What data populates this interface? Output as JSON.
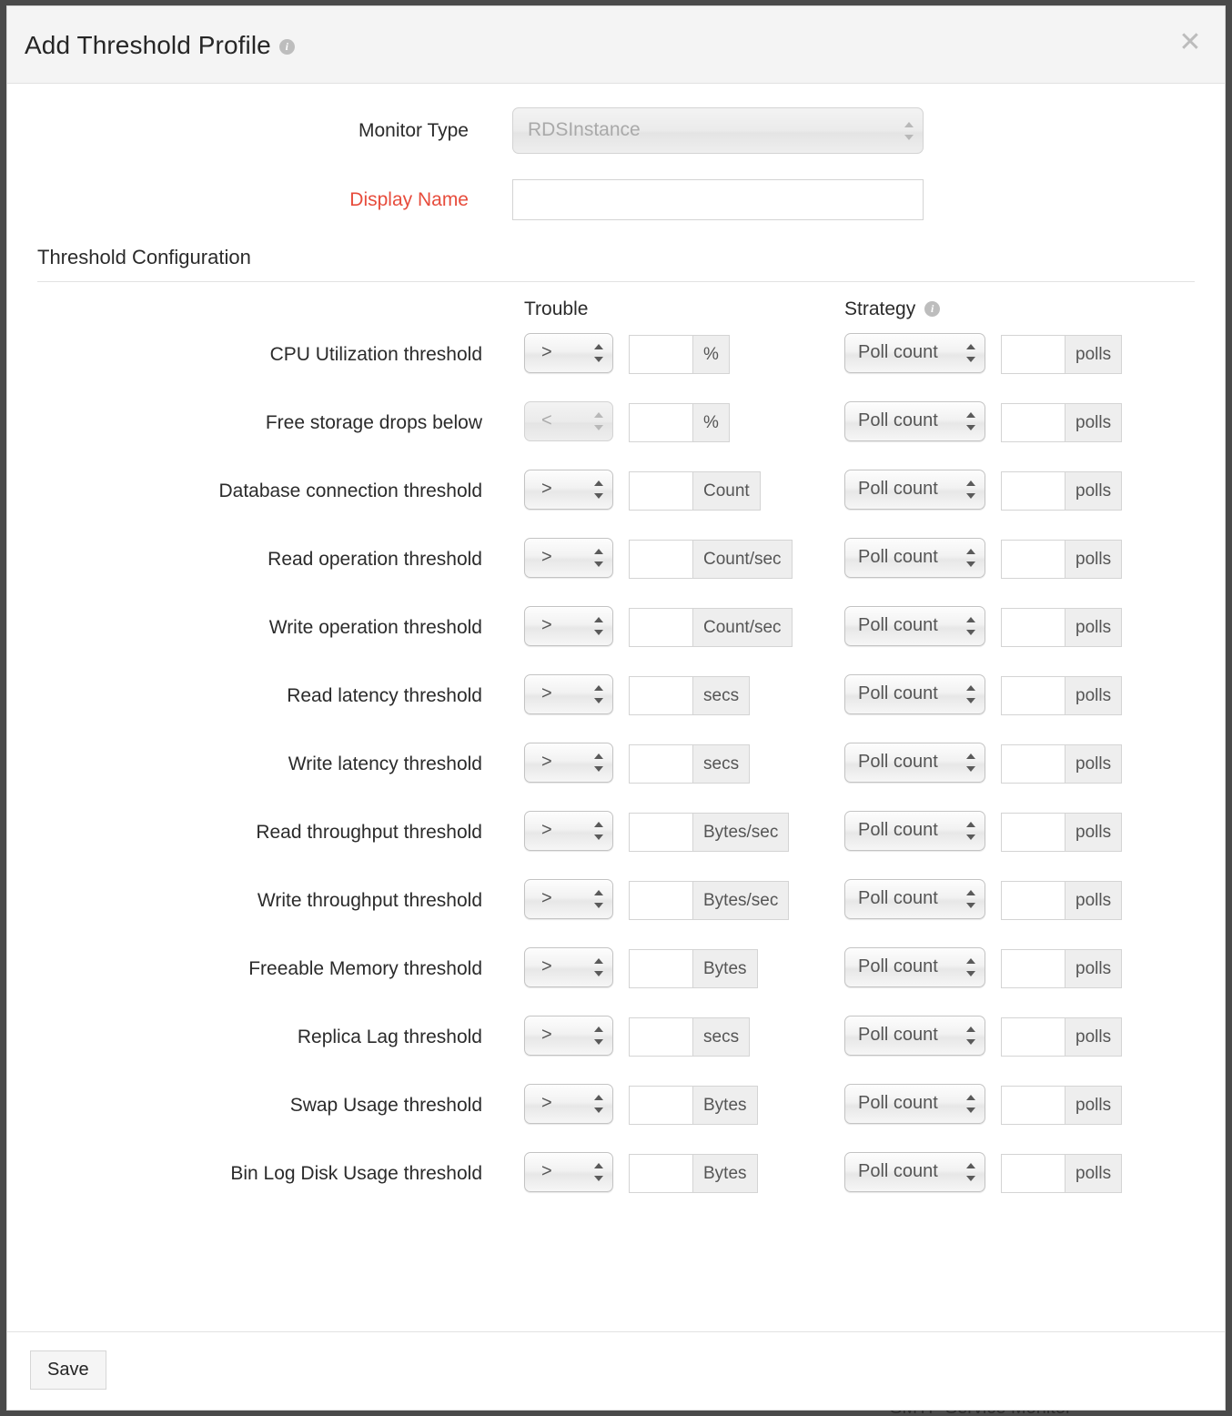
{
  "background": {
    "behind_text": "SMTP Service Monitor"
  },
  "modal": {
    "title": "Add Threshold Profile",
    "title_info_icon": "info-icon",
    "close_icon": "✕",
    "footer": {
      "save_label": "Save"
    }
  },
  "form": {
    "monitor_type": {
      "label": "Monitor Type",
      "value": "RDSInstance",
      "disabled": true
    },
    "display_name": {
      "label": "Display Name",
      "value": "",
      "placeholder": "",
      "required": true
    }
  },
  "threshold_configuration": {
    "section_title": "Threshold Configuration",
    "columns": {
      "trouble": "Trouble",
      "strategy": "Strategy",
      "strategy_info_icon": "info-icon"
    },
    "strategy_default": "Poll count",
    "strategy_unit": "polls",
    "rows": [
      {
        "label": "CPU Utilization threshold",
        "operator": ">",
        "operator_disabled": false,
        "value": "",
        "unit": "%",
        "strategy": "Poll count",
        "poll_value": "",
        "poll_unit": "polls"
      },
      {
        "label": "Free storage drops below",
        "operator": "<",
        "operator_disabled": true,
        "value": "",
        "unit": "%",
        "strategy": "Poll count",
        "poll_value": "",
        "poll_unit": "polls"
      },
      {
        "label": "Database connection threshold",
        "operator": ">",
        "operator_disabled": false,
        "value": "",
        "unit": "Count",
        "strategy": "Poll count",
        "poll_value": "",
        "poll_unit": "polls"
      },
      {
        "label": "Read operation threshold",
        "operator": ">",
        "operator_disabled": false,
        "value": "",
        "unit": "Count/sec",
        "strategy": "Poll count",
        "poll_value": "",
        "poll_unit": "polls"
      },
      {
        "label": "Write operation threshold",
        "operator": ">",
        "operator_disabled": false,
        "value": "",
        "unit": "Count/sec",
        "strategy": "Poll count",
        "poll_value": "",
        "poll_unit": "polls"
      },
      {
        "label": "Read latency threshold",
        "operator": ">",
        "operator_disabled": false,
        "value": "",
        "unit": "secs",
        "strategy": "Poll count",
        "poll_value": "",
        "poll_unit": "polls"
      },
      {
        "label": "Write latency threshold",
        "operator": ">",
        "operator_disabled": false,
        "value": "",
        "unit": "secs",
        "strategy": "Poll count",
        "poll_value": "",
        "poll_unit": "polls"
      },
      {
        "label": "Read throughput threshold",
        "operator": ">",
        "operator_disabled": false,
        "value": "",
        "unit": "Bytes/sec",
        "strategy": "Poll count",
        "poll_value": "",
        "poll_unit": "polls"
      },
      {
        "label": "Write throughput threshold",
        "operator": ">",
        "operator_disabled": false,
        "value": "",
        "unit": "Bytes/sec",
        "strategy": "Poll count",
        "poll_value": "",
        "poll_unit": "polls"
      },
      {
        "label": "Freeable Memory threshold",
        "operator": ">",
        "operator_disabled": false,
        "value": "",
        "unit": "Bytes",
        "strategy": "Poll count",
        "poll_value": "",
        "poll_unit": "polls"
      },
      {
        "label": "Replica Lag threshold",
        "operator": ">",
        "operator_disabled": false,
        "value": "",
        "unit": "secs",
        "strategy": "Poll count",
        "poll_value": "",
        "poll_unit": "polls"
      },
      {
        "label": "Swap Usage threshold",
        "operator": ">",
        "operator_disabled": false,
        "value": "",
        "unit": "Bytes",
        "strategy": "Poll count",
        "poll_value": "",
        "poll_unit": "polls"
      },
      {
        "label": "Bin Log Disk Usage threshold",
        "operator": ">",
        "operator_disabled": false,
        "value": "",
        "unit": "Bytes",
        "strategy": "Poll count",
        "poll_value": "",
        "poll_unit": "polls"
      }
    ]
  },
  "colors": {
    "required_label": "#e74c3c",
    "header_bg": "#f4f4f4",
    "modal_bg": "#ffffff",
    "page_bg": "#4a4a4a",
    "addon_bg": "#eeeeee"
  }
}
